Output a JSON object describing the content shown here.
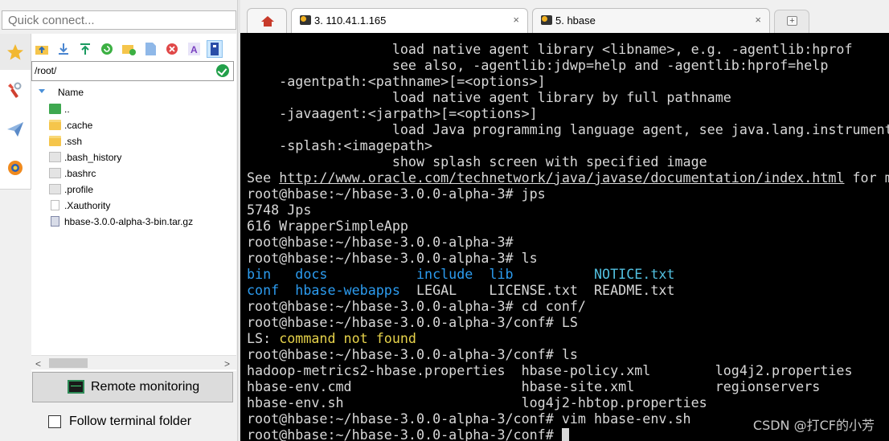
{
  "quick_connect": {
    "placeholder": "Quick connect..."
  },
  "sidebar": {
    "icons": [
      "star-icon",
      "tools-icon",
      "paper-plane-icon",
      "globe-icon"
    ]
  },
  "sftp": {
    "toolbar": [
      "upload-folder-icon",
      "download-icon",
      "upload-icon",
      "refresh-icon",
      "new-folder-icon",
      "new-file-icon",
      "delete-icon",
      "rename-icon",
      "properties-icon"
    ],
    "path": "/root/",
    "column_header": "Name",
    "files": [
      {
        "name": "..",
        "icon": "parent-folder-icon"
      },
      {
        "name": ".cache",
        "icon": "folder-icon"
      },
      {
        "name": ".ssh",
        "icon": "folder-icon"
      },
      {
        "name": ".bash_history",
        "icon": "file-icon"
      },
      {
        "name": ".bashrc",
        "icon": "file-icon"
      },
      {
        "name": ".profile",
        "icon": "file-icon"
      },
      {
        "name": ".Xauthority",
        "icon": "document-icon"
      },
      {
        "name": "hbase-3.0.0-alpha-3-bin.tar.gz",
        "icon": "archive-icon"
      }
    ],
    "remote_monitoring": "Remote monitoring",
    "follow_terminal": "Follow terminal folder"
  },
  "tabs": [
    {
      "title": "3. 110.41.1.165",
      "close": "×",
      "active": true
    },
    {
      "title": "5. hbase",
      "close": "×",
      "active": false
    }
  ],
  "terminal": {
    "lines": [
      "                  load native agent library <libname>, e.g. -agentlib:hprof",
      "                  see also, -agentlib:jdwp=help and -agentlib:hprof=help",
      "    -agentpath:<pathname>[=<options>]",
      "                  load native agent library by full pathname",
      "    -javaagent:<jarpath>[=<options>]",
      "                  load Java programming language agent, see java.lang.instrument",
      "    -splash:<imagepath>",
      "                  show splash screen with specified image",
      "See http://www.oracle.com/technetwork/java/javase/documentation/index.html for m",
      "root@hbase:~/hbase-3.0.0-alpha-3# jps",
      "5748 Jps",
      "616 WrapperSimpleApp",
      "root@hbase:~/hbase-3.0.0-alpha-3#",
      "root@hbase:~/hbase-3.0.0-alpha-3# ls",
      "bin   docs           include  lib          NOTICE.txt",
      "conf  hbase-webapps  LEGAL    LICENSE.txt  README.txt",
      "root@hbase:~/hbase-3.0.0-alpha-3# cd conf/",
      "root@hbase:~/hbase-3.0.0-alpha-3/conf# LS",
      "LS: command not found",
      "root@hbase:~/hbase-3.0.0-alpha-3/conf# ls",
      "hadoop-metrics2-hbase.properties  hbase-policy.xml        log4j2.properties",
      "hbase-env.cmd                     hbase-site.xml          regionservers",
      "hbase-env.sh                      log4j2-hbtop.properties",
      "root@hbase:~/hbase-3.0.0-alpha-3/conf# vim hbase-env.sh",
      "root@hbase:~/hbase-3.0.0-alpha-3/conf# "
    ],
    "link": "http://www.oracle.com/technetwork/java/javase/documentation/index.html",
    "watermark": "CSDN @打CF的小芳",
    "colors": {
      "dir": "#2c9cf0",
      "exec": "#52c0e0",
      "error": "#e6d24a"
    }
  }
}
